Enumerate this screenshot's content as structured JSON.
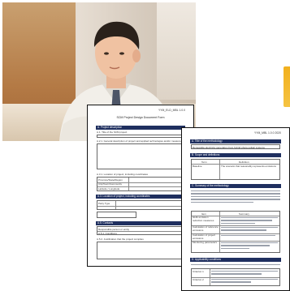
{
  "photo": {
    "description_icon": "person-at-desk-photo"
  },
  "back_doc": {
    "ref": "YYM_ELD_MBL 1.0.0",
    "title": "SCM Project Design Document Form",
    "sections": [
      {
        "label": "A. Project description"
      },
      {
        "label": "A.1. Title of the SCM project"
      },
      {
        "label": "A.2. Technical description of project and emission reductions"
      },
      {
        "label": "A.3. Location of project, including coordinates"
      },
      {
        "label": "A.4. Parties and project participants"
      },
      {
        "label": "A.5. Contacts"
      }
    ],
    "texts": {
      "a21": "A.2.1. General description of project and applied technologies and/or measures",
      "a31": "A.3.1. Location of project, including coordinates",
      "row1": "Province/State/Region",
      "row2": "City/Town/Community",
      "row3": "Latitude / Longitude",
      "a41": "Party  Type",
      "a51": "Responsible person or entity",
      "a52": "A.5.1. Conditions",
      "a53": "A.5.2. Justification that the project complies"
    }
  },
  "front_doc": {
    "ref": "YYM_MBL  1.0.0  2020",
    "sections": [
      {
        "label": "A.  Title of the methodology"
      },
      {
        "label": "B.  Scope and definitions"
      },
      {
        "label": "C.  Summary of the methodology"
      },
      {
        "label": "D.  Applicability conditions"
      }
    ],
    "texts": {
      "title_line": "Renewable electricity generation from hybrid photo-voltaic systems",
      "def_h1": "Term",
      "def_h2": "Definition",
      "def_r1a": "Baseline",
      "def_r1b": "The scenario that reasonably represents emissions",
      "summary_h1": "Item",
      "summary_h2": "Summary",
      "sum_r1": "GHG emission reduction measures",
      "sum_r2": "Calculation of reference emissions",
      "sum_r3": "Calculation of project emissions",
      "sum_r4": "Monitoring parameters",
      "app_r1": "Criterion 1",
      "app_r2": "Criterion 2"
    }
  }
}
